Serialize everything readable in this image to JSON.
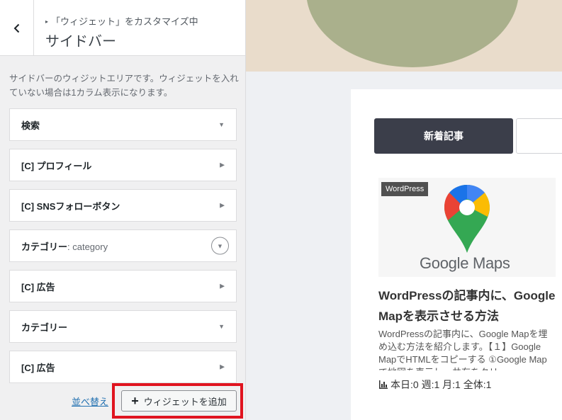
{
  "header": {
    "breadcrumb": "「ウィジェット」をカスタマイズ中",
    "title": "サイドバー"
  },
  "area_description": "サイドバーのウィジットエリアです。ウィジェットを入れていない場合は1カラム表示になります。",
  "widgets": [
    {
      "label": "検索",
      "sub": "",
      "state": "expanded"
    },
    {
      "label": "[C] プロフィール",
      "sub": "",
      "state": "collapsed"
    },
    {
      "label": "[C] SNSフォローボタン",
      "sub": "",
      "state": "collapsed"
    },
    {
      "label": "カテゴリー",
      "sub": ": category",
      "state": "focused"
    },
    {
      "label": "[C] 広告",
      "sub": "",
      "state": "collapsed"
    },
    {
      "label": "カテゴリー",
      "sub": "",
      "state": "expanded"
    },
    {
      "label": "[C] 広告",
      "sub": "",
      "state": "collapsed"
    }
  ],
  "footer": {
    "reorder_label": "並べ替え",
    "add_widget_label": "ウィジェットを追加"
  },
  "preview": {
    "tab_active_label": "新着記事",
    "post": {
      "category": "WordPress",
      "thumbnail_text": "Google Maps",
      "title": "WordPressの記事内に、Google Mapを表示させる方法",
      "excerpt": "WordPressの記事内に、Google Mapを埋め込む方法を紹介します。【１】Google MapでHTMLをコピーする ①Google Mapで地図を表示し、共有をクリ",
      "views": "本日:0 週:1 月:1 全体:1"
    }
  },
  "colors": {
    "highlight_border": "#e0141f",
    "tab_active_bg": "#3b3e4a",
    "link": "#2271b1"
  }
}
